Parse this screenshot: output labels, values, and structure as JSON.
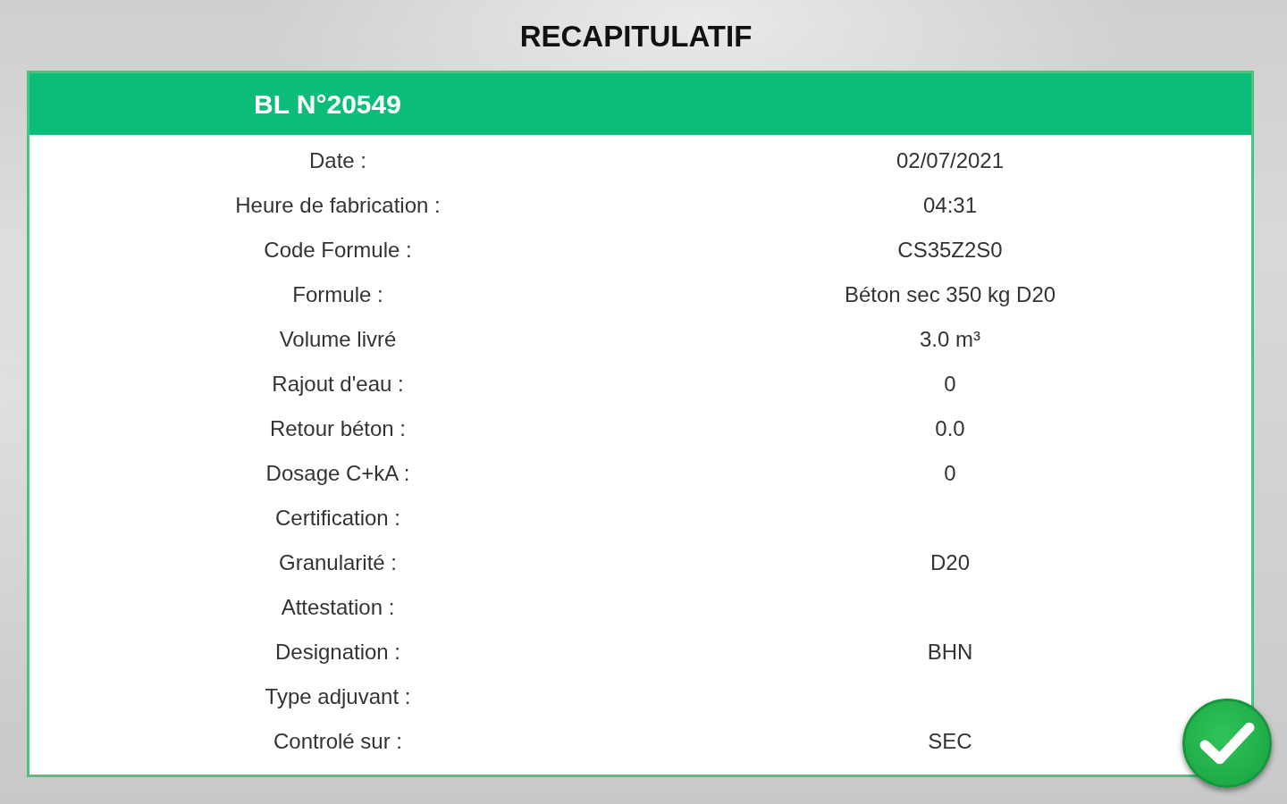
{
  "title": "RECAPITULATIF",
  "card": {
    "header": "BL N°20549",
    "rows": [
      {
        "label": "Date :",
        "value": "02/07/2021"
      },
      {
        "label": "Heure de fabrication :",
        "value": "04:31"
      },
      {
        "label": "Code Formule :",
        "value": "CS35Z2S0"
      },
      {
        "label": "Formule :",
        "value": "Béton sec 350 kg D20"
      },
      {
        "label": "Volume livré",
        "value": "3.0 m³"
      },
      {
        "label": "Rajout d'eau :",
        "value": "0"
      },
      {
        "label": "Retour béton :",
        "value": "0.0"
      },
      {
        "label": "Dosage C+kA :",
        "value": "0"
      },
      {
        "label": "Certification :"
      },
      {
        "label": "Granularité :",
        "value": "D20"
      },
      {
        "label": "Attestation :"
      },
      {
        "label": "Designation :",
        "value": "BHN"
      },
      {
        "label": "Type adjuvant :"
      },
      {
        "label": "Controlé sur :",
        "value": "SEC"
      }
    ]
  }
}
